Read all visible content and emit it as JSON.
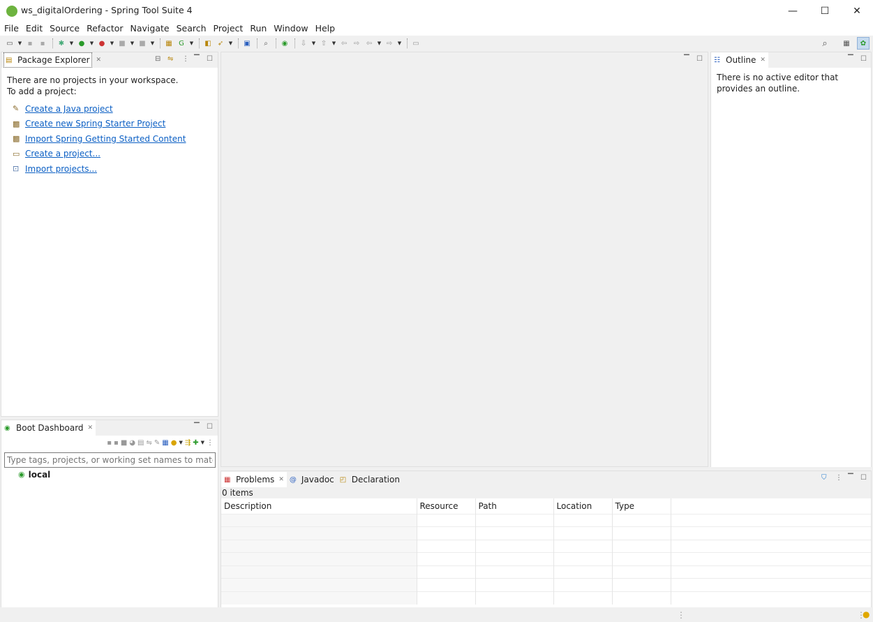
{
  "window": {
    "title": "ws_digitalOrdering - Spring Tool Suite 4",
    "minimize_glyph": "—",
    "maximize_glyph": "☐",
    "close_glyph": "✕"
  },
  "menu": [
    "File",
    "Edit",
    "Source",
    "Refactor",
    "Navigate",
    "Search",
    "Project",
    "Run",
    "Window",
    "Help"
  ],
  "package_explorer": {
    "tab_label": "Package Explorer",
    "empty_line1": "There are no projects in your workspace.",
    "empty_line2": "To add a project:",
    "links": [
      {
        "label": "Create a Java project",
        "icon": "java-project-icon"
      },
      {
        "label": "Create new Spring Starter Project",
        "icon": "spring-starter-icon"
      },
      {
        "label": "Import Spring Getting Started Content",
        "icon": "spring-import-icon"
      },
      {
        "label": "Create a project...",
        "icon": "new-project-icon"
      },
      {
        "label": "Import projects...",
        "icon": "import-projects-icon"
      }
    ]
  },
  "boot_dashboard": {
    "tab_label": "Boot Dashboard",
    "filter_placeholder": "Type tags, projects, or working set names to match (in",
    "tree_item": "local"
  },
  "outline": {
    "tab_label": "Outline",
    "message": "There is no active editor that provides an outline."
  },
  "bottom_panel": {
    "tabs": [
      "Problems",
      "Javadoc",
      "Declaration"
    ],
    "item_count": "0 items",
    "columns": [
      "Description",
      "Resource",
      "Path",
      "Location",
      "Type"
    ]
  },
  "colors": {
    "link": "#0b5fc4",
    "spring_green": "#6db33f",
    "background": "#f0f0f0"
  }
}
